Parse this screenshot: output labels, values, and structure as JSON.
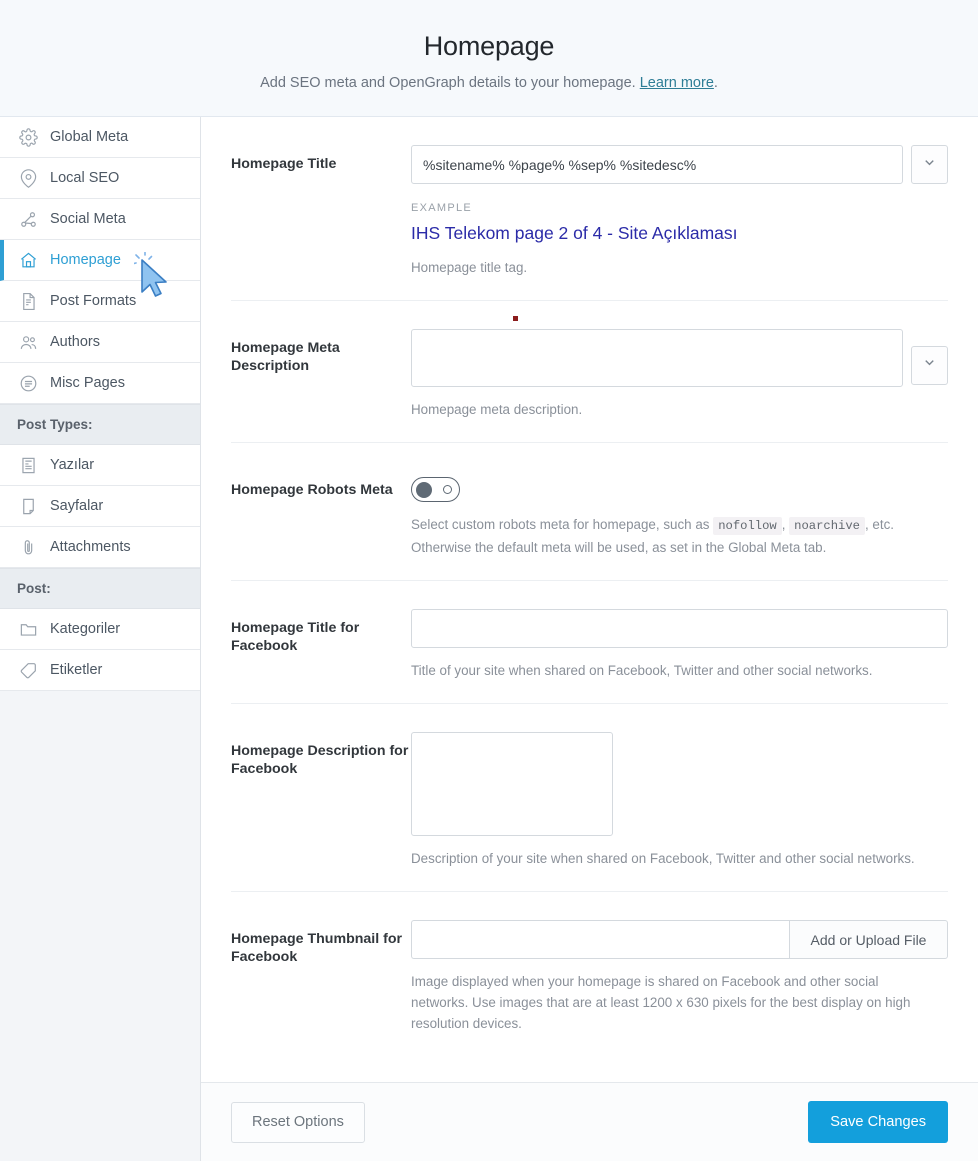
{
  "header": {
    "title": "Homepage",
    "subtitle_before": "Add SEO meta and OpenGraph details to your homepage. ",
    "link_label": "Learn more",
    "subtitle_after": "."
  },
  "sidebar": {
    "items": [
      {
        "label": "Global Meta",
        "icon": "gear-icon",
        "active": false
      },
      {
        "label": "Local SEO",
        "icon": "map-pin-icon",
        "active": false
      },
      {
        "label": "Social Meta",
        "icon": "share-nodes-icon",
        "active": false
      },
      {
        "label": "Homepage",
        "icon": "home-icon",
        "active": true
      },
      {
        "label": "Post Formats",
        "icon": "document-icon",
        "active": false
      },
      {
        "label": "Authors",
        "icon": "users-icon",
        "active": false
      },
      {
        "label": "Misc Pages",
        "icon": "list-circle-icon",
        "active": false
      }
    ],
    "groups": [
      {
        "label": "Post Types:",
        "after_index": 6
      },
      {
        "label": "Post:",
        "after_index": 9
      }
    ],
    "post_types": [
      {
        "label": "Yazılar",
        "icon": "article-icon"
      },
      {
        "label": "Sayfalar",
        "icon": "page-icon"
      },
      {
        "label": "Attachments",
        "icon": "paperclip-icon"
      }
    ],
    "post_taxonomies": [
      {
        "label": "Kategoriler",
        "icon": "folder-icon"
      },
      {
        "label": "Etiketler",
        "icon": "tag-icon"
      }
    ],
    "group_post_types_label": "Post Types:",
    "group_post_label": "Post:"
  },
  "fields": {
    "homepage_title": {
      "label": "Homepage Title",
      "value": "%sitename% %page% %sep% %sitedesc%",
      "placeholder": "",
      "example_label": "EXAMPLE",
      "example_value": "IHS Telekom page 2 of 4 - Site Açıklaması",
      "help": "Homepage title tag.",
      "dropdown_icon": "chevron-down-icon"
    },
    "homepage_meta_description": {
      "label": "Homepage Meta Description",
      "value": "",
      "placeholder": "",
      "help": "Homepage meta description.",
      "dropdown_icon": "chevron-down-icon"
    },
    "homepage_robots_meta": {
      "label": "Homepage Robots Meta",
      "toggle_state": "off",
      "help_part1": "Select custom robots meta for homepage, such as ",
      "code1": "nofollow",
      "help_part2": ", ",
      "code2": "noarchive",
      "help_part3": ", etc. Otherwise the default meta will be used, as set in the Global Meta tab."
    },
    "homepage_title_facebook": {
      "label": "Homepage Title for Facebook",
      "value": "",
      "placeholder": "",
      "help": "Title of your site when shared on Facebook, Twitter and other social networks."
    },
    "homepage_description_facebook": {
      "label": "Homepage Description for Facebook",
      "value": "",
      "placeholder": "",
      "help": "Description of your site when shared on Facebook, Twitter and other social networks."
    },
    "homepage_thumbnail_facebook": {
      "label": "Homepage Thumbnail for Facebook",
      "value": "",
      "placeholder": "",
      "upload_button": "Add or Upload File",
      "help": "Image displayed when your homepage is shared on Facebook and other social networks. Use images that are at least 1200 x 630 pixels for the best display on high resolution devices."
    }
  },
  "footer": {
    "reset_label": "Reset Options",
    "save_label": "Save Changes"
  },
  "colors": {
    "accent": "#139fdc",
    "active_nav": "#2e9fd4",
    "example_title": "#2b2ba8",
    "link": "#2e7d96",
    "red_dot": "#8b1c1c"
  }
}
